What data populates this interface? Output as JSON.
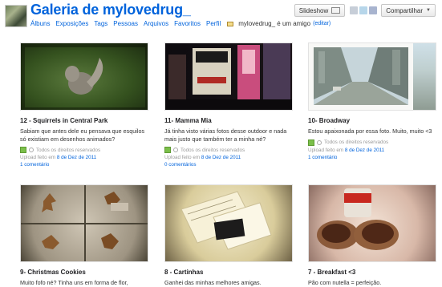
{
  "header": {
    "title": "Galeria de mylovedrug_",
    "nav": [
      "Álbuns",
      "Exposições",
      "Tags",
      "Pessoas",
      "Arquivos",
      "Favoritos",
      "Perfil"
    ],
    "contact_text": "mylovedrug_ é um amigo",
    "edit_label": "(editar)",
    "slideshow_label": "Slideshow",
    "share_label": "Compartilhar"
  },
  "photos": [
    {
      "title": "12 - Squirrels in Central Park",
      "description": "Sabiam que antes dele eu pensava que esquilos só existiam em desenhos animados?",
      "rights": "Todos os direitos reservados",
      "uploaded_prefix": "Upload feito em",
      "uploaded_date": "8 de Dez de 2011",
      "comments": "1 comentário"
    },
    {
      "title": "11- Mamma Mia",
      "description": "Já tinha visto várias fotos desse outdoor e nada mais justo que também ter a minha né?",
      "rights": "Todos os direitos reservados",
      "uploaded_prefix": "Upload feito em",
      "uploaded_date": "8 de Dez de 2011",
      "comments": "0 comentários"
    },
    {
      "title": "10- Broadway",
      "description": "Estou apaixonada por essa foto. Muito, muito <3",
      "rights": "Todos os direitos reservados",
      "uploaded_prefix": "Upload feito em",
      "uploaded_date": "8 de Dez de 2011",
      "comments": "1 comentário"
    },
    {
      "title": "9- Christmas Cookies",
      "description": "Muito fofo né? Tinha uns em forma de flor,"
    },
    {
      "title": "8 - Cartinhas",
      "description": "Ganhei das minhas melhores amigas."
    },
    {
      "title": "7 - Breakfast <3",
      "description": "Pão com nutella = perfeição."
    }
  ],
  "icons": {
    "rights_icon": "green-square-icon",
    "cc_icon": "copyright-icon",
    "mail_icon": "envelope-icon"
  }
}
